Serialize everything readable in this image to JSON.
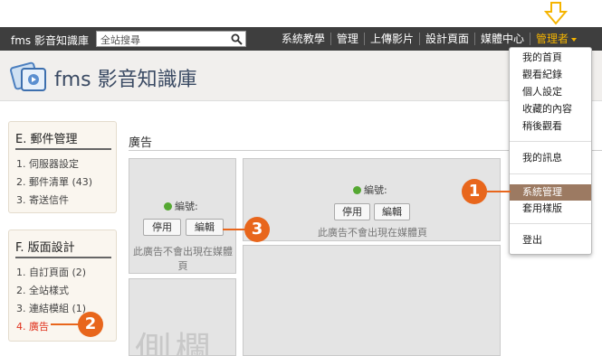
{
  "topbar": {
    "site_name": "fms 影音知識庫",
    "search_placeholder": "全站搜尋",
    "nav": [
      "系統教學",
      "管理",
      "上傳影片",
      "設計頁面",
      "媒體中心"
    ],
    "admin_label": "管理者"
  },
  "header": {
    "logo_text": "fms 影音知識庫"
  },
  "sidebar": {
    "box1": {
      "title": "E. 郵件管理",
      "items": [
        "1. 伺服器設定",
        "2. 郵件清單 (43)",
        "3. 寄送信件"
      ]
    },
    "box2": {
      "title": "F. 版面設計",
      "items": [
        "1. 自訂頁面 (2)",
        "2. 全站樣式",
        "3. 連結模組 (1)",
        "4. 廣告"
      ]
    }
  },
  "main": {
    "section_title": "廣告",
    "panel_left": {
      "label": "編號:",
      "btn_disable": "停用",
      "btn_edit": "編輯",
      "note": "此廣告不會出現在媒體頁"
    },
    "panel_right": {
      "label": "編號:",
      "btn_disable": "停用",
      "btn_edit": "編輯",
      "note": "此廣告不會出現在媒體頁"
    },
    "sidebar_panel_text": "側欄"
  },
  "dropdown": {
    "items": [
      "我的首頁",
      "觀看紀錄",
      "個人設定",
      "收藏的內容",
      "稍後觀看",
      "我的訊息",
      "系統管理",
      "套用樣版",
      "登出"
    ],
    "active_index": 6
  },
  "callouts": [
    "1",
    "2",
    "3"
  ],
  "colors": {
    "topbar": "#3e3e3e",
    "accent_orange": "#e8661c",
    "admin_yellow": "#f5b400",
    "active_menu": "#9c7a62"
  }
}
